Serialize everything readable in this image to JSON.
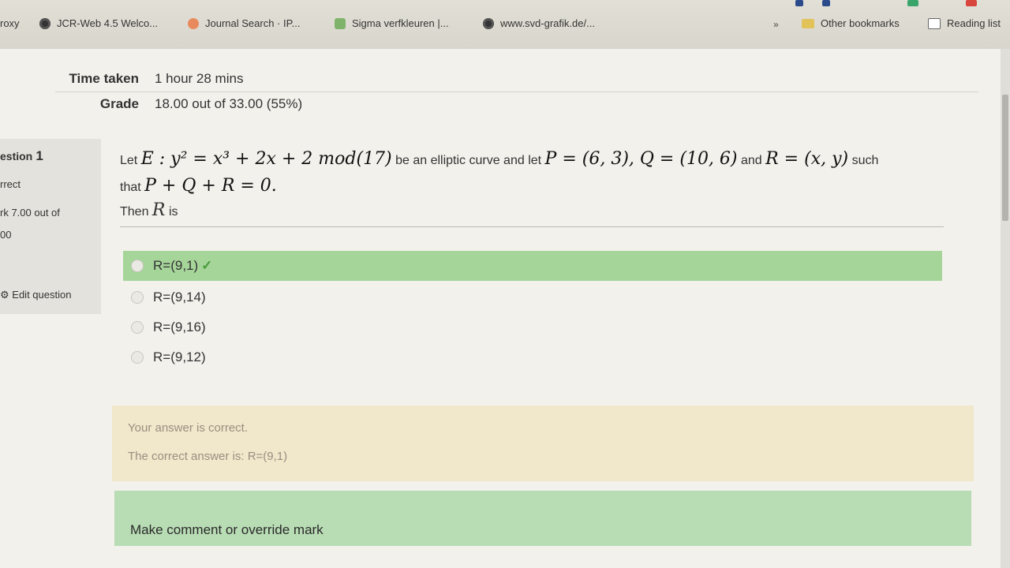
{
  "bookmarks": [
    {
      "label": "roxy",
      "icon": "none"
    },
    {
      "label": "JCR-Web 4.5 Welco...",
      "icon": "globe-icon"
    },
    {
      "label": "Journal Search · IP...",
      "icon": "journal-icon"
    },
    {
      "label": "Sigma verfkleuren |...",
      "icon": "leaf-icon"
    },
    {
      "label": "www.svd-grafik.de/...",
      "icon": "globe-icon"
    }
  ],
  "bookmarks_more": "»",
  "other_bookmarks": "Other bookmarks",
  "reading_list": "Reading list",
  "summary": {
    "time_label": "Time taken",
    "time_value": "1 hour 28 mins",
    "grade_label": "Grade",
    "grade_value": "18.00 out of 33.00 (55%)"
  },
  "question_info": {
    "number_prefix": "estion",
    "number": "1",
    "status": "rrect",
    "mark_line1": "rk 7.00 out of",
    "mark_line2": "00",
    "edit": "Edit question"
  },
  "question": {
    "let": "Let",
    "curve_math": "E : y² = x³ + 2x + 2  mod(17)",
    "curve_text": "be an elliptic curve and let",
    "p_math": "P = (6, 3), Q = (10, 6)",
    "and": "and",
    "r_math": "R = (x, y)",
    "such": "such",
    "that": "that",
    "sum_math": "P + Q + R = 0.",
    "then": "Then",
    "then_var": "R",
    "is": "is"
  },
  "options": [
    {
      "label": "R=(9,1)",
      "correct": true
    },
    {
      "label": "R=(9,14)",
      "correct": false
    },
    {
      "label": "R=(9,16)",
      "correct": false
    },
    {
      "label": "R=(9,12)",
      "correct": false
    }
  ],
  "check_mark": "✓",
  "feedback": {
    "result": "Your answer is correct.",
    "correct_answer": "The correct answer is: R=(9,1)"
  },
  "comment_link": "Make comment or override mark",
  "colors": {
    "correct_bg": "#a6d59a",
    "feedback_bg": "#f1e7cb",
    "comment_bg": "#b8dcb4"
  }
}
